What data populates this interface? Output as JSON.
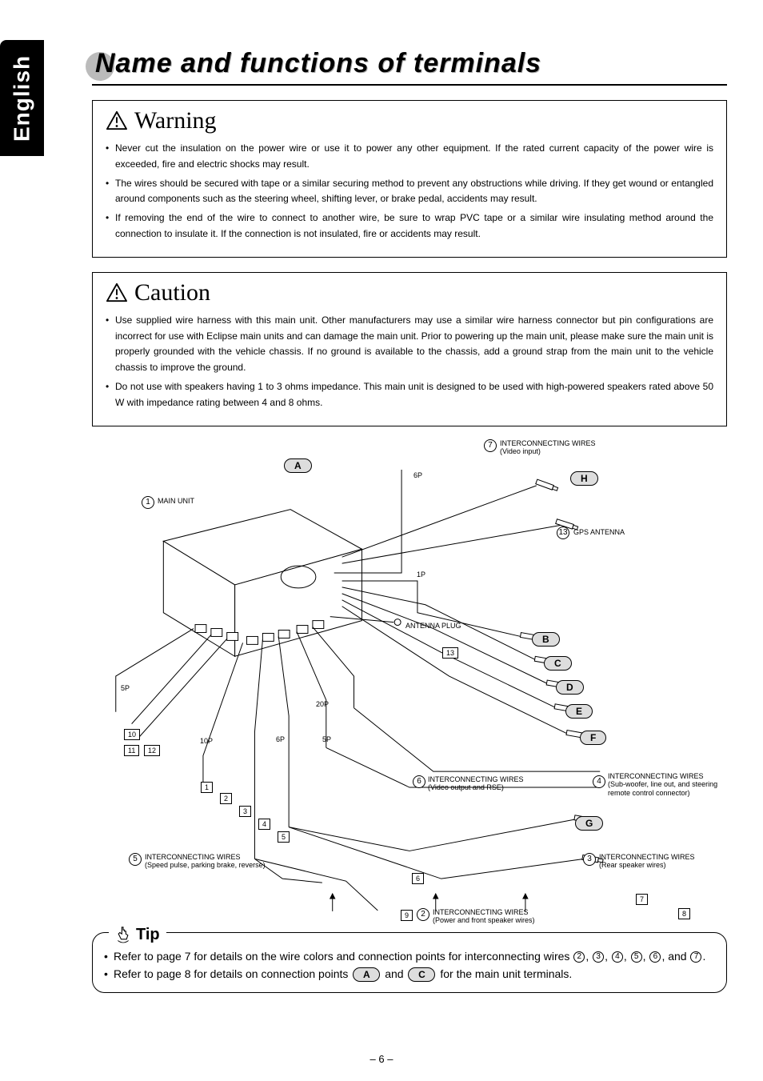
{
  "lang_tab": "English",
  "title": "Name and functions of terminals",
  "warning": {
    "heading": "Warning",
    "items": [
      "Never cut the insulation on the power wire or use it to power any other equipment. If the rated current capacity of the power wire is exceeded, fire and electric shocks may result.",
      "The wires should be secured with tape or a similar securing method to prevent any obstructions while driving. If they get wound or entangled around components such as the steering wheel, shifting lever, or brake pedal, accidents may result.",
      "If removing the end of the wire to connect to another wire, be sure to wrap PVC tape or a similar wire insulating method around the connection to insulate it. If the connection is not insulated, fire or accidents may result."
    ]
  },
  "caution": {
    "heading": "Caution",
    "items": [
      "Use supplied wire harness with this main unit.  Other manufacturers may use a similar wire harness connector but pin configurations are incorrect for use with Eclipse main units and can damage the main unit.  Prior to powering up the main unit, please make sure the main unit is properly grounded with the vehicle chassis.  If no ground is available to the chassis, add a ground strap from the main unit to the vehicle chassis to improve the ground.",
      "Do not use with speakers having 1 to 3 ohms impedance.  This main unit is designed to be used with high-powered speakers rated above 50 W with impedance rating between 4 and 8 ohms."
    ]
  },
  "diagram": {
    "pill_A": "A",
    "pill_B": "B",
    "pill_C": "C",
    "pill_D": "D",
    "pill_E": "E",
    "pill_F": "F",
    "pill_G": "G",
    "pill_H": "H",
    "c1": "1",
    "c2": "2",
    "c3": "3",
    "c4": "4",
    "c5": "5",
    "c6": "6",
    "c7": "7",
    "c13": "13",
    "b1": "1",
    "b2": "2",
    "b3": "3",
    "b4": "4",
    "b5": "5",
    "b6": "6",
    "b7": "7",
    "b8": "8",
    "b9": "9",
    "b10": "10",
    "b11": "11",
    "b12": "12",
    "b13": "13",
    "p1P": "1P",
    "p5P_l": "5P",
    "p5P_r": "5P",
    "p6P_top": "6P",
    "p6P_bot": "6P",
    "p10P": "10P",
    "p20P": "20P",
    "lbl_main_unit": "MAIN UNIT",
    "lbl_gps": "GPS ANTENNA",
    "lbl_antenna_plug": "ANTENNA PLUG",
    "lbl_ic7": "INTERCONNECTING WIRES",
    "lbl_ic7_sub": "(Video input)",
    "lbl_ic6": "INTERCONNECTING WIRES",
    "lbl_ic6_sub": "(Video output and RSE)",
    "lbl_ic5": "INTERCONNECTING WIRES",
    "lbl_ic5_sub": "(Speed pulse, parking brake, reverse)",
    "lbl_ic4": "INTERCONNECTING WIRES",
    "lbl_ic4_sub": "(Sub-woofer, line out, and steering remote control connector)",
    "lbl_ic3": "INTERCONNECTING WIRES",
    "lbl_ic3_sub": "(Rear speaker wires)",
    "lbl_ic2": "INTERCONNECTING WIRES",
    "lbl_ic2_sub": "(Power and front speaker wires)"
  },
  "tip": {
    "heading": "Tip",
    "line1_pre": "Refer to page 7 for details on the wire colors and connection points for interconnecting wires ",
    "line1_post": ".",
    "and": " and ",
    "comma_sep": ", ",
    "line2_pre": "Refer to page 8 for details on connection points ",
    "line2_mid": " and ",
    "line2_post": " for the main unit terminals.",
    "nums": {
      "n2": "2",
      "n3": "3",
      "n4": "4",
      "n5": "5",
      "n6": "6",
      "n7": "7"
    },
    "pills": {
      "A": "A",
      "C": "C"
    }
  },
  "page_number": "– 6 –"
}
